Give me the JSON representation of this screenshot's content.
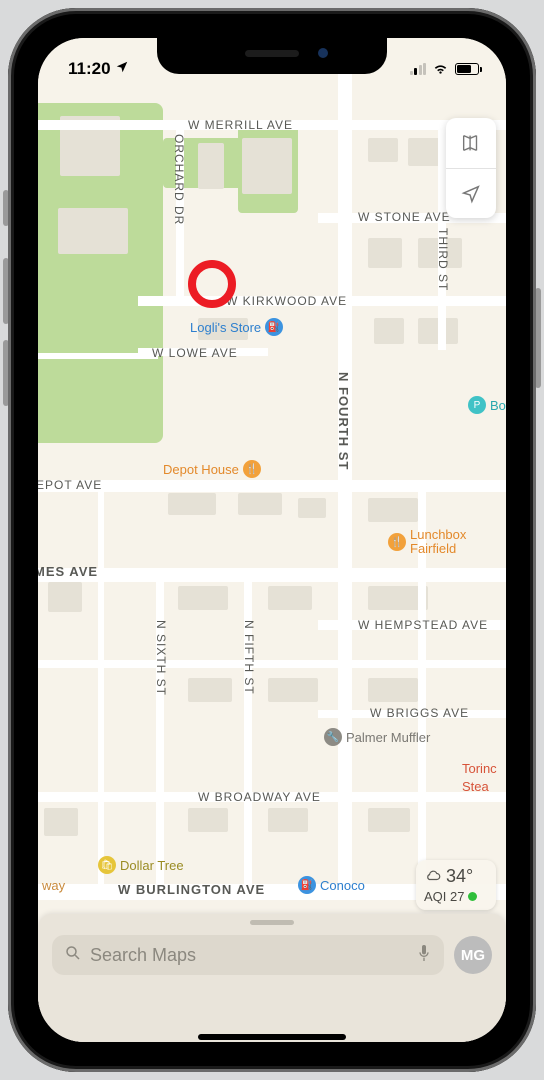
{
  "status": {
    "time": "11:20",
    "battery_pct": 70
  },
  "streets": {
    "merrill": "W MERRILL AVE",
    "stone": "W STONE AVE",
    "kirkwood": "W KIRKWOOD AVE",
    "lowe": "W LOWE AVE",
    "depot": "EPOT AVE",
    "ames": "MES AVE",
    "hempstead": "W HEMPSTEAD AVE",
    "briggs": "W BRIGGS AVE",
    "broadway": "W BROADWAY AVE",
    "burlington": "W BURLINGTON AVE",
    "orchard": "ORCHARD DR",
    "fourth": "N FOURTH ST",
    "third": "THIRD ST",
    "sixth": "N SIXTH ST",
    "fifth": "N FIFTH ST"
  },
  "pois": {
    "logli": "Logli's Store",
    "bo": "Bo",
    "depot_house": "Depot House",
    "lunchbox1": "Lunchbox",
    "lunchbox2": "Fairfield",
    "palmer": "Palmer Muffler",
    "torino1": "Torinc",
    "torino2": "Stea",
    "dollar": "Dollar Tree",
    "conoco": "Conoco",
    "hway": "way"
  },
  "weather": {
    "temp": "34°",
    "aqi_label": "AQI 27"
  },
  "search": {
    "placeholder": "Search Maps"
  },
  "avatar": {
    "initials": "MG"
  }
}
